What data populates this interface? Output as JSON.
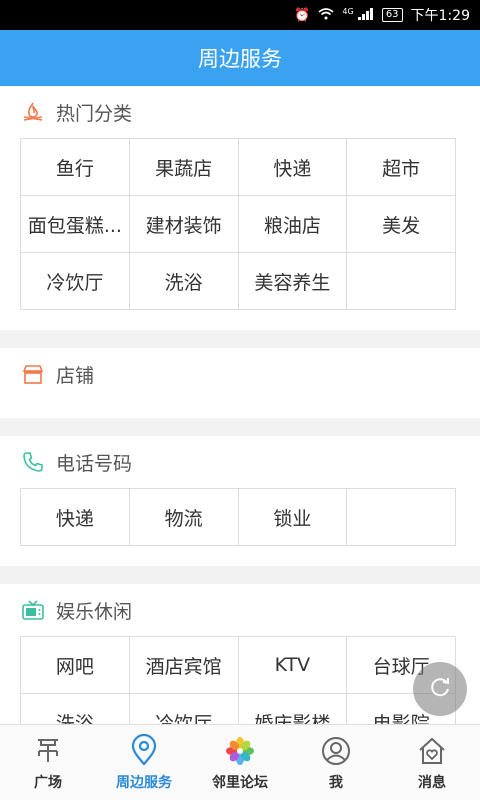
{
  "status_bar": {
    "signal_label": "4G",
    "battery": "63",
    "time": "下午1:29"
  },
  "header": {
    "title": "周边服务"
  },
  "sections": {
    "hot": {
      "title": "热门分类",
      "items": [
        "鱼行",
        "果蔬店",
        "快递",
        "超市",
        "面包蛋糕...",
        "建材装饰",
        "粮油店",
        "美发",
        "冷饮厅",
        "洗浴",
        "美容养生",
        ""
      ]
    },
    "store": {
      "title": "店铺"
    },
    "phone": {
      "title": "电话号码",
      "items": [
        "快递",
        "物流",
        "锁业",
        ""
      ]
    },
    "fun": {
      "title": "娱乐休闲",
      "items": [
        "网吧",
        "酒店宾馆",
        "KTV",
        "台球厅",
        "洗浴",
        "冷饮厅",
        "婚庆影楼",
        "电影院"
      ]
    }
  },
  "tabs": [
    {
      "label": "广场",
      "icon": "plaza-icon"
    },
    {
      "label": "周边服务",
      "icon": "location-icon",
      "active": true
    },
    {
      "label": "邻里论坛",
      "icon": "flower-icon"
    },
    {
      "label": "我",
      "icon": "user-icon"
    },
    {
      "label": "消息",
      "icon": "house-heart-icon"
    }
  ],
  "colors": {
    "primary": "#3aa2f0",
    "hot_icon": "#f07a4a",
    "store_icon": "#f07a4a",
    "phone_icon": "#3bbfa0",
    "fun_icon": "#3bbfa0",
    "active_tab": "#2b8ad8"
  }
}
